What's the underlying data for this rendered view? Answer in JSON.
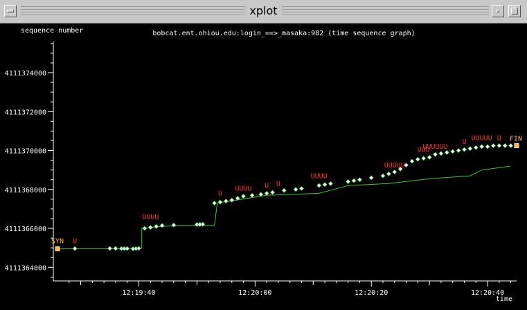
{
  "window": {
    "title": "xplot"
  },
  "chart_data": {
    "type": "line",
    "title": "bobcat.ent.ohiou.edu:login_==>_masaka:982 (time sequence graph)",
    "ylabel": "sequence number",
    "xlabel": "time",
    "y_ticks": [
      "4111364000",
      "4111366000",
      "4111368000",
      "4111370000",
      "4111372000",
      "4111374000"
    ],
    "x_ticks": [
      "12:19:40",
      "12:20:00",
      "12:20:20",
      "12:20:40"
    ],
    "ylim": [
      4111363300,
      4111375600
    ],
    "xlim_seconds": [
      26,
      105
    ],
    "ack_line": [
      [
        26,
        4111364950
      ],
      [
        36,
        4111364950
      ],
      [
        39,
        4111364980
      ],
      [
        40.5,
        4111364980
      ],
      [
        40.5,
        4111366000
      ],
      [
        44,
        4111366100
      ],
      [
        47,
        4111366150
      ],
      [
        53,
        4111366150
      ],
      [
        53.5,
        4111367300
      ],
      [
        62,
        4111367700
      ],
      [
        71,
        4111367800
      ],
      [
        76,
        4111368200
      ],
      [
        83,
        4111368300
      ],
      [
        90,
        4111368550
      ],
      [
        97,
        4111368700
      ],
      [
        99,
        4111369000
      ],
      [
        104,
        4111369200
      ]
    ],
    "segments": [
      [
        26,
        4111364950
      ],
      [
        29,
        4111364960
      ],
      [
        35,
        4111364970
      ],
      [
        36,
        4111364970
      ],
      [
        37,
        4111364960
      ],
      [
        37.5,
        4111364960
      ],
      [
        38,
        4111364960
      ],
      [
        39,
        4111364950
      ],
      [
        39.5,
        4111364960
      ],
      [
        40,
        4111364970
      ],
      [
        41,
        4111366000
      ],
      [
        42,
        4111366050
      ],
      [
        43,
        4111366100
      ],
      [
        44,
        4111366150
      ],
      [
        46,
        4111366170
      ],
      [
        50,
        4111366200
      ],
      [
        50.5,
        4111366200
      ],
      [
        51,
        4111366210
      ],
      [
        53,
        4111367300
      ],
      [
        54,
        4111367350
      ],
      [
        55,
        4111367400
      ],
      [
        56,
        4111367450
      ],
      [
        57,
        4111367550
      ],
      [
        58,
        4111367650
      ],
      [
        59.5,
        4111367700
      ],
      [
        61,
        4111367750
      ],
      [
        62,
        4111367800
      ],
      [
        63,
        4111367850
      ],
      [
        65,
        4111367950
      ],
      [
        67,
        4111368000
      ],
      [
        68,
        4111368050
      ],
      [
        71,
        4111368200
      ],
      [
        72,
        4111368250
      ],
      [
        73,
        4111368300
      ],
      [
        76,
        4111368400
      ],
      [
        77,
        4111368450
      ],
      [
        78,
        4111368500
      ],
      [
        80,
        4111368600
      ],
      [
        82,
        4111368700
      ],
      [
        83,
        4111368800
      ],
      [
        84,
        4111368900
      ],
      [
        85,
        4111369050
      ],
      [
        86,
        4111369250
      ],
      [
        87,
        4111369450
      ],
      [
        88,
        4111369550
      ],
      [
        89,
        4111369600
      ],
      [
        90,
        4111369650
      ],
      [
        91,
        4111369800
      ],
      [
        92,
        4111369850
      ],
      [
        93,
        4111369900
      ],
      [
        94,
        4111369950
      ],
      [
        95,
        4111370000
      ],
      [
        96,
        4111370050
      ],
      [
        97,
        4111370100
      ],
      [
        98,
        4111370150
      ],
      [
        99,
        4111370200
      ],
      [
        100,
        4111370200
      ],
      [
        101,
        4111370250
      ],
      [
        102,
        4111370250
      ],
      [
        103,
        4111370250
      ],
      [
        104,
        4111370250
      ],
      [
        105,
        4111370250
      ]
    ],
    "markers": [
      {
        "label": "SYN",
        "t": 26,
        "seq": 4111364950
      },
      {
        "label": "U",
        "t": 29,
        "seq": 4111364960
      },
      {
        "label": "UUUU",
        "t": 42,
        "seq": 4111366200
      },
      {
        "label": "U",
        "t": 54,
        "seq": 4111367400
      },
      {
        "label": "UUUU",
        "t": 58,
        "seq": 4111367650
      },
      {
        "label": "U",
        "t": 62,
        "seq": 4111367800
      },
      {
        "label": "U",
        "t": 64,
        "seq": 4111367900
      },
      {
        "label": "UUUU",
        "t": 71,
        "seq": 4111368300
      },
      {
        "label": "UUUUU",
        "t": 84,
        "seq": 4111368850
      },
      {
        "label": "UUU",
        "t": 89,
        "seq": 4111369650
      },
      {
        "label": "UUUUUU",
        "t": 91,
        "seq": 4111369800
      },
      {
        "label": "U",
        "t": 96,
        "seq": 4111370050
      },
      {
        "label": "UUUUU",
        "t": 99,
        "seq": 4111370250
      },
      {
        "label": "U",
        "t": 102,
        "seq": 4111370250
      },
      {
        "label": "FIN",
        "t": 105,
        "seq": 4111370250
      }
    ],
    "colors": {
      "background": "#000000",
      "axis": "#ffffff",
      "text": "#ffffff",
      "ack_line": "#2ecc2e",
      "segment": "#ffffff",
      "segment_edge": "#2ecc2e",
      "urg": "#ff3030",
      "syn_fin": "#ffb347"
    }
  }
}
